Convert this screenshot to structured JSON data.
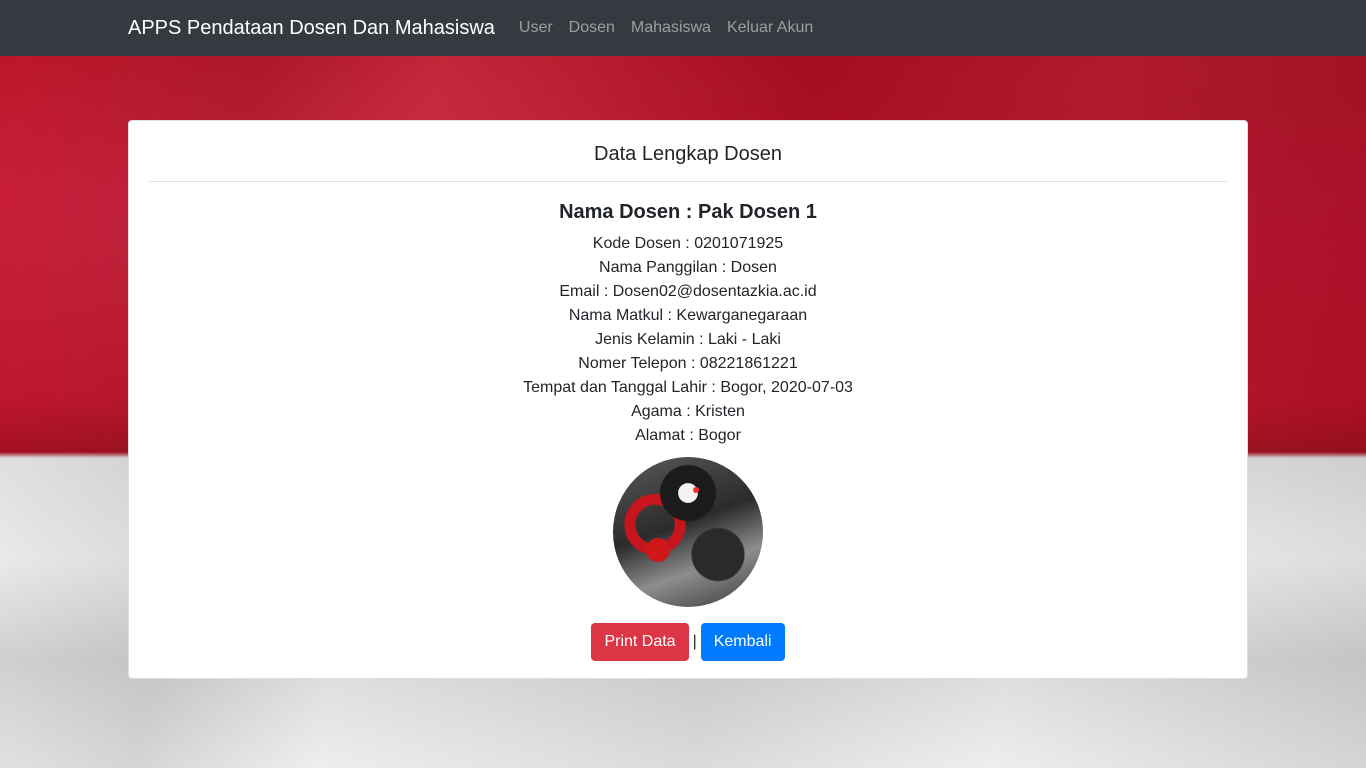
{
  "navbar": {
    "brand": "APPS Pendataan Dosen Dan Mahasiswa",
    "links": [
      "User",
      "Dosen",
      "Mahasiswa",
      "Keluar Akun"
    ]
  },
  "card": {
    "title": "Data Lengkap Dosen",
    "name_line": "Nama Dosen : Pak Dosen 1",
    "details": [
      "Kode Dosen : 0201071925",
      "Nama Panggilan : Dosen",
      "Email : Dosen02@dosentazkia.ac.id",
      "Nama Matkul : Kewarganegaraan",
      "Jenis Kelamin : Laki - Laki",
      "Nomer Telepon : 08221861221",
      "Tempat dan Tanggal Lahir : Bogor, 2020-07-03",
      "Agama : Kristen",
      "Alamat : Bogor"
    ],
    "separator": "|",
    "buttons": {
      "print": "Print Data",
      "back": "Kembali"
    }
  },
  "colors": {
    "navbar_bg": "#343a40",
    "danger": "#dc3545",
    "primary": "#007bff"
  }
}
